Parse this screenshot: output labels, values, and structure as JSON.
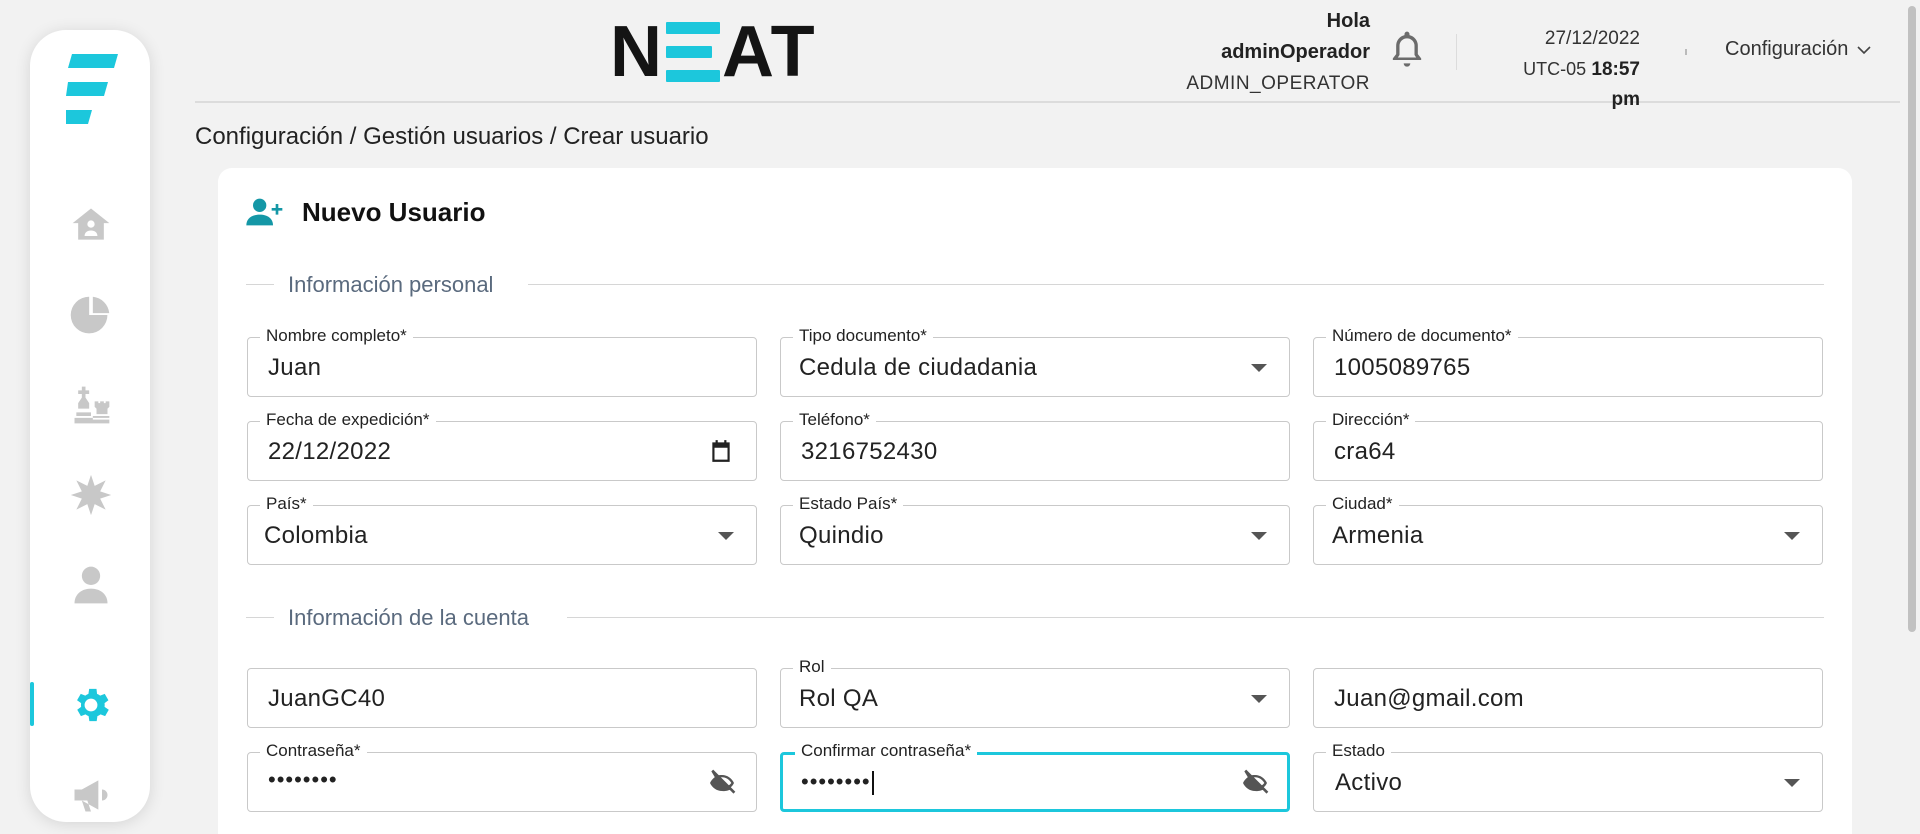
{
  "brand": {
    "name": "NEAT",
    "accent_color": "#1cc7dc"
  },
  "sidebar": {
    "items": [
      {
        "icon": "home-icon",
        "active": false
      },
      {
        "icon": "pie-chart-icon",
        "active": false
      },
      {
        "icon": "chess-icon",
        "active": false
      },
      {
        "icon": "burst-icon",
        "active": false
      },
      {
        "icon": "user-icon",
        "active": false
      },
      {
        "icon": "gear-icon",
        "active": true
      },
      {
        "icon": "megaphone-icon",
        "active": false
      }
    ]
  },
  "header": {
    "greeting": "Hola",
    "username": "adminOperador",
    "role": "ADMIN_OPERATOR",
    "date": "27/12/2022",
    "timezone": "UTC-05",
    "time": "18:57 pm",
    "config_menu": "Configuración"
  },
  "breadcrumb": "Configuración / Gestión usuarios / Crear usuario",
  "card": {
    "title": "Nuevo Usuario",
    "sections": {
      "personal": "Información personal",
      "account": "Información de la cuenta"
    },
    "fields": {
      "full_name": {
        "label": "Nombre completo*",
        "value": "Juan"
      },
      "doc_type": {
        "label": "Tipo documento*",
        "value": "Cedula de ciudadania"
      },
      "doc_number": {
        "label": "Número de documento*",
        "value": "1005089765"
      },
      "issue_date": {
        "label": "Fecha de expedición*",
        "value": "22/12/2022"
      },
      "phone": {
        "label": "Teléfono*",
        "value": "3216752430"
      },
      "address": {
        "label": "Dirección*",
        "value": "cra64"
      },
      "country": {
        "label": "País*",
        "value": "Colombia"
      },
      "state": {
        "label": "Estado País*",
        "value": "Quindio"
      },
      "city": {
        "label": "Ciudad*",
        "value": "Armenia"
      },
      "username": {
        "label": "",
        "value": "JuanGC40"
      },
      "role": {
        "label": "Rol",
        "value": "Rol QA"
      },
      "email": {
        "label": "",
        "value": "Juan@gmail.com"
      },
      "password": {
        "label": "Contraseña*",
        "value": "••••••••"
      },
      "confirm_password": {
        "label": "Confirmar contraseña*",
        "value": "••••••••"
      },
      "status": {
        "label": "Estado",
        "value": "Activo"
      }
    }
  }
}
